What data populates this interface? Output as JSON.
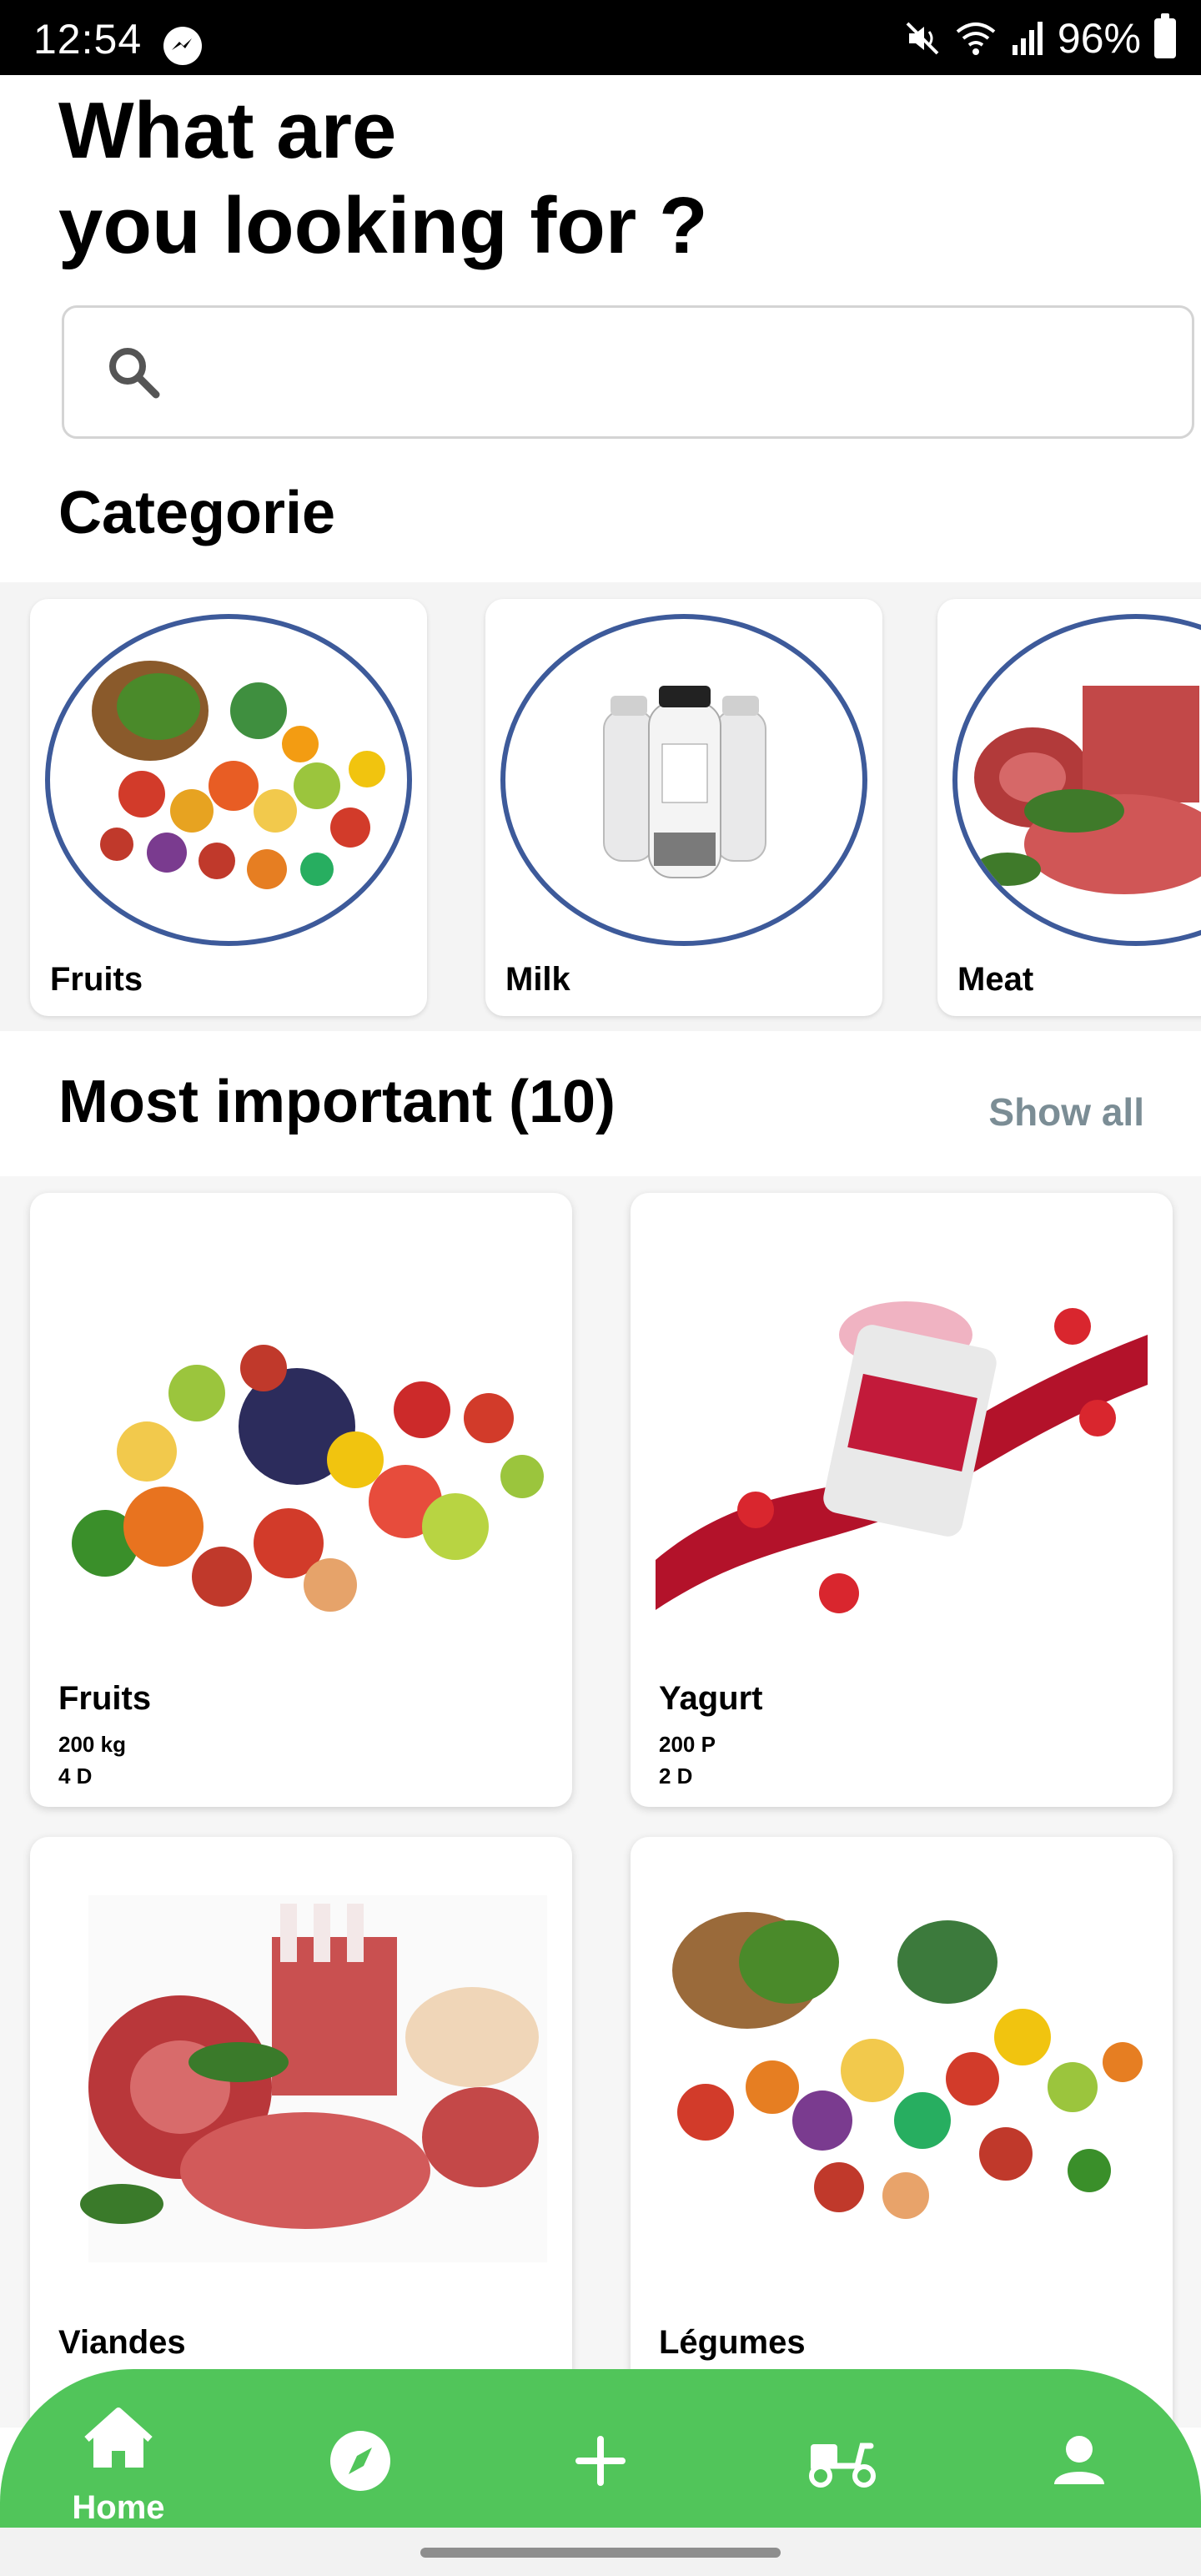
{
  "status_bar": {
    "time": "12:54",
    "battery": "96%",
    "icons": [
      "messenger-icon",
      "mute-icon",
      "wifi-icon",
      "signal-icon",
      "battery-icon"
    ]
  },
  "header": {
    "line1": "What are",
    "line2": "you looking for ?"
  },
  "search": {
    "value": "",
    "placeholder": ""
  },
  "categories": {
    "title": "Categorie",
    "items": [
      {
        "label": "Fruits",
        "icon": "fruit-basket-image"
      },
      {
        "label": "Milk",
        "icon": "milk-bottles-image"
      },
      {
        "label": "Meat",
        "icon": "meat-image"
      }
    ]
  },
  "most_important": {
    "title": "Most important (10)",
    "show_all_label": "Show all",
    "products": [
      {
        "name": "Fruits",
        "qty": "200 kg",
        "price": "4 D"
      },
      {
        "name": "Yagurt",
        "qty": "200 P",
        "price": "2 D"
      },
      {
        "name": "Viandes",
        "qty": "",
        "price": ""
      },
      {
        "name": "Légumes",
        "qty": "",
        "price": ""
      }
    ]
  },
  "bottom_nav": {
    "items": [
      {
        "label": "Home",
        "icon": "home-icon"
      },
      {
        "label": "",
        "icon": "compass-icon"
      },
      {
        "label": "",
        "icon": "plus-icon"
      },
      {
        "label": "",
        "icon": "delivery-scooter-icon"
      },
      {
        "label": "",
        "icon": "profile-icon"
      }
    ]
  },
  "colors": {
    "nav_green": "#51c55a",
    "circle_border": "#3d5a9a",
    "show_all": "#7b8d95"
  }
}
